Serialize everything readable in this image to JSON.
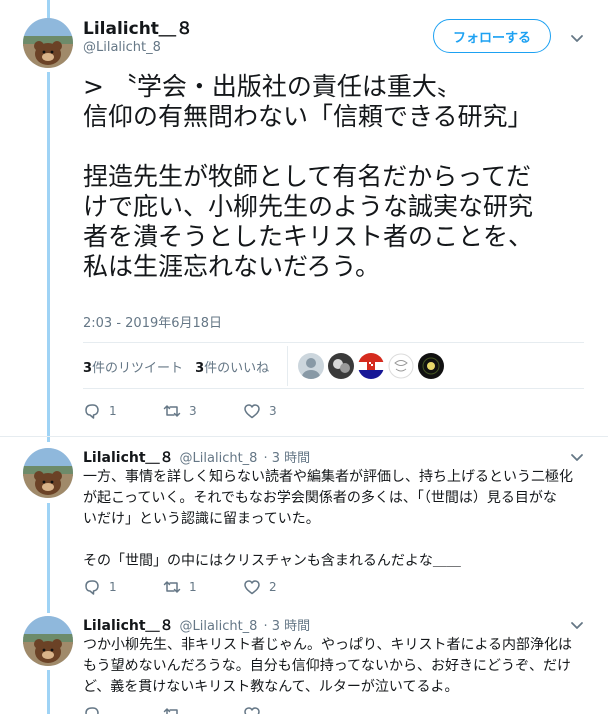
{
  "main_tweet": {
    "name": "Lilalicht＿８",
    "handle": "@Lilalicht_8",
    "follow_label": "フォローする",
    "lines": [
      "> 〝学会・出版社の責任は重大〟",
      "信仰の有無問わない「信頼できる研究」",
      "",
      "捏造先生が牧師として有名だからってだ",
      "けで庇い、小柳先生のような誠実な研究",
      "者を潰そうとしたキリスト者のことを、",
      "私は生涯忘れないだろう。"
    ],
    "timestamp": "2:03 - 2019年6月18日",
    "retweets_count": "3",
    "retweets_label": "件のリツイート",
    "likes_count": "3",
    "likes_label": "件のいいね",
    "actions": {
      "replies": "1",
      "retweets": "3",
      "likes": "3"
    }
  },
  "replies": [
    {
      "name": "Lilalicht＿８",
      "handle": "@Lilalicht_8",
      "time": "· 3 時間",
      "lines": [
        "一方、事情を詳しく知らない読者や編集者が評価し、持ち上げるという二極化",
        "が起こっていく。それでもなお学会関係者の多くは、「（世間は）見る目がな",
        "いだけ」という認識に留まっていた。",
        "",
        "その「世間」の中にはクリスチャンも含まれるんだよな＿＿"
      ],
      "actions": {
        "replies": "1",
        "retweets": "1",
        "likes": "2"
      }
    },
    {
      "name": "Lilalicht＿８",
      "handle": "@Lilalicht_8",
      "time": "· 3 時間",
      "lines": [
        "つか小柳先生、非キリスト者じゃん。やっぱり、キリスト者による内部浄化は",
        "もう望めないんだろうな。自分も信仰持ってないから、お好きにどうぞ、だけ",
        "ど、義を貫けないキリスト教なんて、ルターが泣いてるよ。"
      ],
      "actions": {
        "replies": "",
        "retweets": "",
        "likes": ""
      }
    }
  ],
  "icons": {
    "reply": "reply-icon",
    "retweet": "retweet-icon",
    "like": "heart-icon",
    "more": "chevron-down-icon"
  },
  "colors": {
    "accent": "#1da1f2",
    "thread_line": "#9fd3f5",
    "secondary_text": "#657786"
  }
}
